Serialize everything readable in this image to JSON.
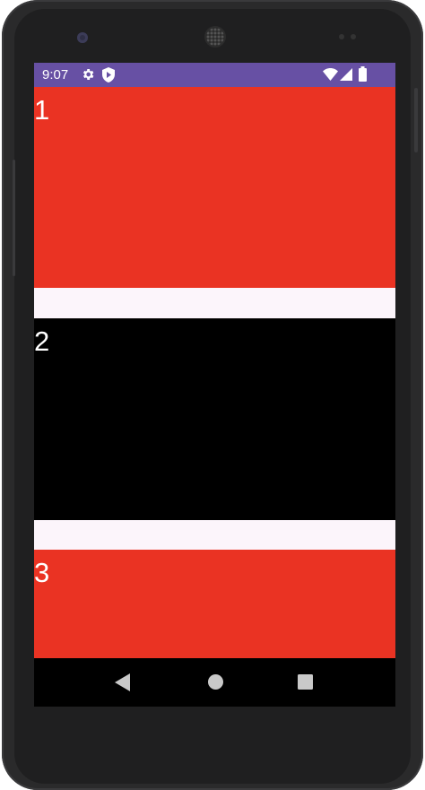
{
  "status_bar": {
    "time": "9:07",
    "left_icons": [
      "settings-icon",
      "shield-play-icon"
    ],
    "right_icons": [
      "wifi-icon",
      "signal-icon",
      "battery-icon"
    ],
    "background": "#6750a4"
  },
  "tiles": [
    {
      "label": "1",
      "color": "#ea3323"
    },
    {
      "label": "2",
      "color": "#000000"
    },
    {
      "label": "3",
      "color": "#ea3323"
    }
  ],
  "page_background": "#fcf5fb",
  "nav_bar": {
    "buttons": [
      "back-triangle-icon",
      "home-circle-icon",
      "recents-square-icon"
    ],
    "icon_color": "#c9c9c9"
  }
}
